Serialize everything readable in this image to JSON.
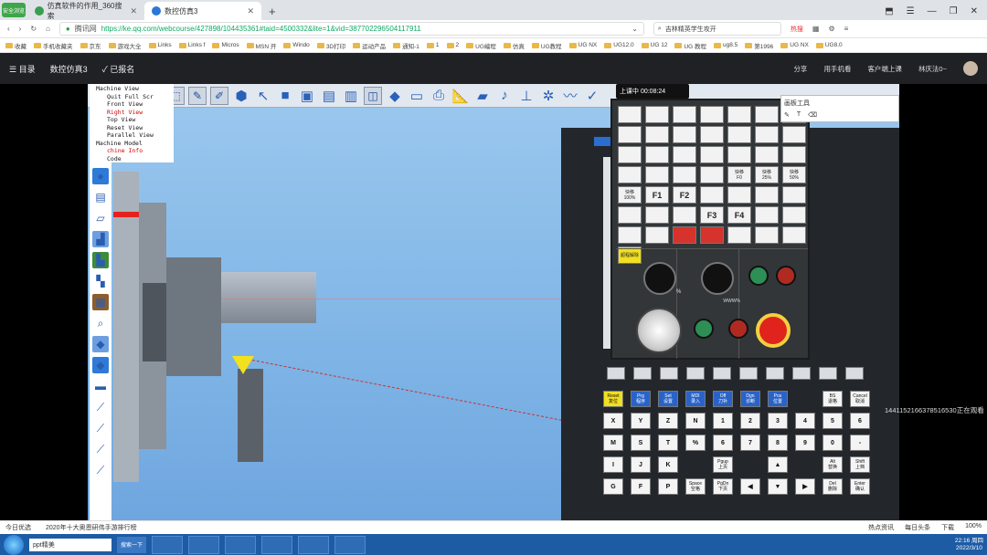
{
  "browser": {
    "logo_text": "安全浏览",
    "tabs": [
      {
        "title": "仿真软件的作用_360搜索"
      },
      {
        "title": "数控仿真3"
      }
    ],
    "new_tab": "+",
    "url_prefix": "腾讯网",
    "url": "https://ke.qq.com/webcourse/427898/104435361#taid=4500332&lite=1&vid=387702296504117911",
    "search_text": "吉林精英学生攻开",
    "hot_label": "热搜",
    "bookmarks": [
      "收藏",
      "手机收藏夹",
      "京东",
      "游戏大全",
      "Links",
      "Links f",
      "Micros",
      "MSN 开",
      "Windo",
      "3D打印",
      "运动产品",
      "通知-1",
      "1",
      "2",
      "UG编程",
      "仿真",
      "UG教程",
      "UG NX",
      "UG12.0",
      "UG 12",
      "UG 教程",
      "ug8.5",
      "第1996",
      "UG NX",
      "UG8.0"
    ]
  },
  "course_bar": {
    "menu_label": "目录",
    "title": "数控仿真3",
    "signed_label": "已报名",
    "right_items": [
      "分享",
      "用手机看",
      "客户端上课",
      "林庆法0~"
    ]
  },
  "simulator": {
    "tree": [
      {
        "label": "Machine View",
        "level": 0
      },
      {
        "label": "Quit Full Scr",
        "level": 1
      },
      {
        "label": "Front View",
        "level": 1
      },
      {
        "label": "Right View",
        "level": 1,
        "selected": true
      },
      {
        "label": "Top View",
        "level": 1
      },
      {
        "label": "Reset View",
        "level": 1
      },
      {
        "label": "Parallel View",
        "level": 1
      },
      {
        "label": "Machine Model",
        "level": 0
      },
      {
        "label": "chine Info",
        "level": 1,
        "selected": true
      },
      {
        "label": "Code",
        "level": 1
      }
    ],
    "float_bar": "上课中 00:08:24",
    "tool_popup": "画板工具",
    "stream_id": "1441152166378516530正在观看"
  },
  "panel": {
    "top_keys": [
      "",
      "",
      "",
      "",
      "",
      "",
      "",
      "",
      "",
      "",
      "",
      "",
      "",
      "",
      "",
      "",
      "",
      "",
      "",
      "",
      "",
      "",
      "",
      "",
      "",
      "快移\nF0",
      "快移\n25%",
      "快移\n50%",
      "快移\n100%",
      "F1",
      "F2",
      "",
      "",
      "",
      "",
      "",
      "",
      "",
      "F3",
      "F4",
      "",
      "",
      "",
      "",
      "",
      "",
      "",
      "",
      "",
      "超程解除"
    ],
    "dial1_label": "%",
    "dial2_label": "WWW%",
    "keys": [
      [
        "Reset\n复位",
        "Prg\n程序",
        "Set\n设置",
        "MDI\n录入",
        "Off\n刀补",
        "Dgn\n诊断",
        "Pos\n位置",
        "",
        "BS\n退格",
        "Cancel\n取消"
      ],
      [
        "X",
        "Y",
        "Z",
        "N",
        "1",
        "2",
        "3",
        "4",
        "5",
        "6"
      ],
      [
        "M",
        "S",
        "T",
        "%",
        "6",
        "7",
        "8",
        "9",
        "0",
        "-"
      ],
      [
        "I",
        "J",
        "K",
        "",
        "Pgup\n上页",
        "",
        "▲",
        "",
        "Alt\n替换",
        "Shift\n上档"
      ],
      [
        "G",
        "F",
        "P",
        "Space\n空格",
        "PgDn\n下页",
        "◀",
        "▼",
        "▶",
        "Del\n删除",
        "Enter\n确认"
      ]
    ]
  },
  "status_bar": {
    "left": [
      "今日优选",
      "2020年十大奥恩研伟手游排行榜"
    ],
    "right": [
      "热点资讯",
      "每日头条",
      "下载",
      "100%"
    ]
  },
  "taskbar": {
    "search": "ppt精美",
    "search_btn": "搜索一下",
    "time": "22:16 周四",
    "date": "2022/3/10"
  }
}
